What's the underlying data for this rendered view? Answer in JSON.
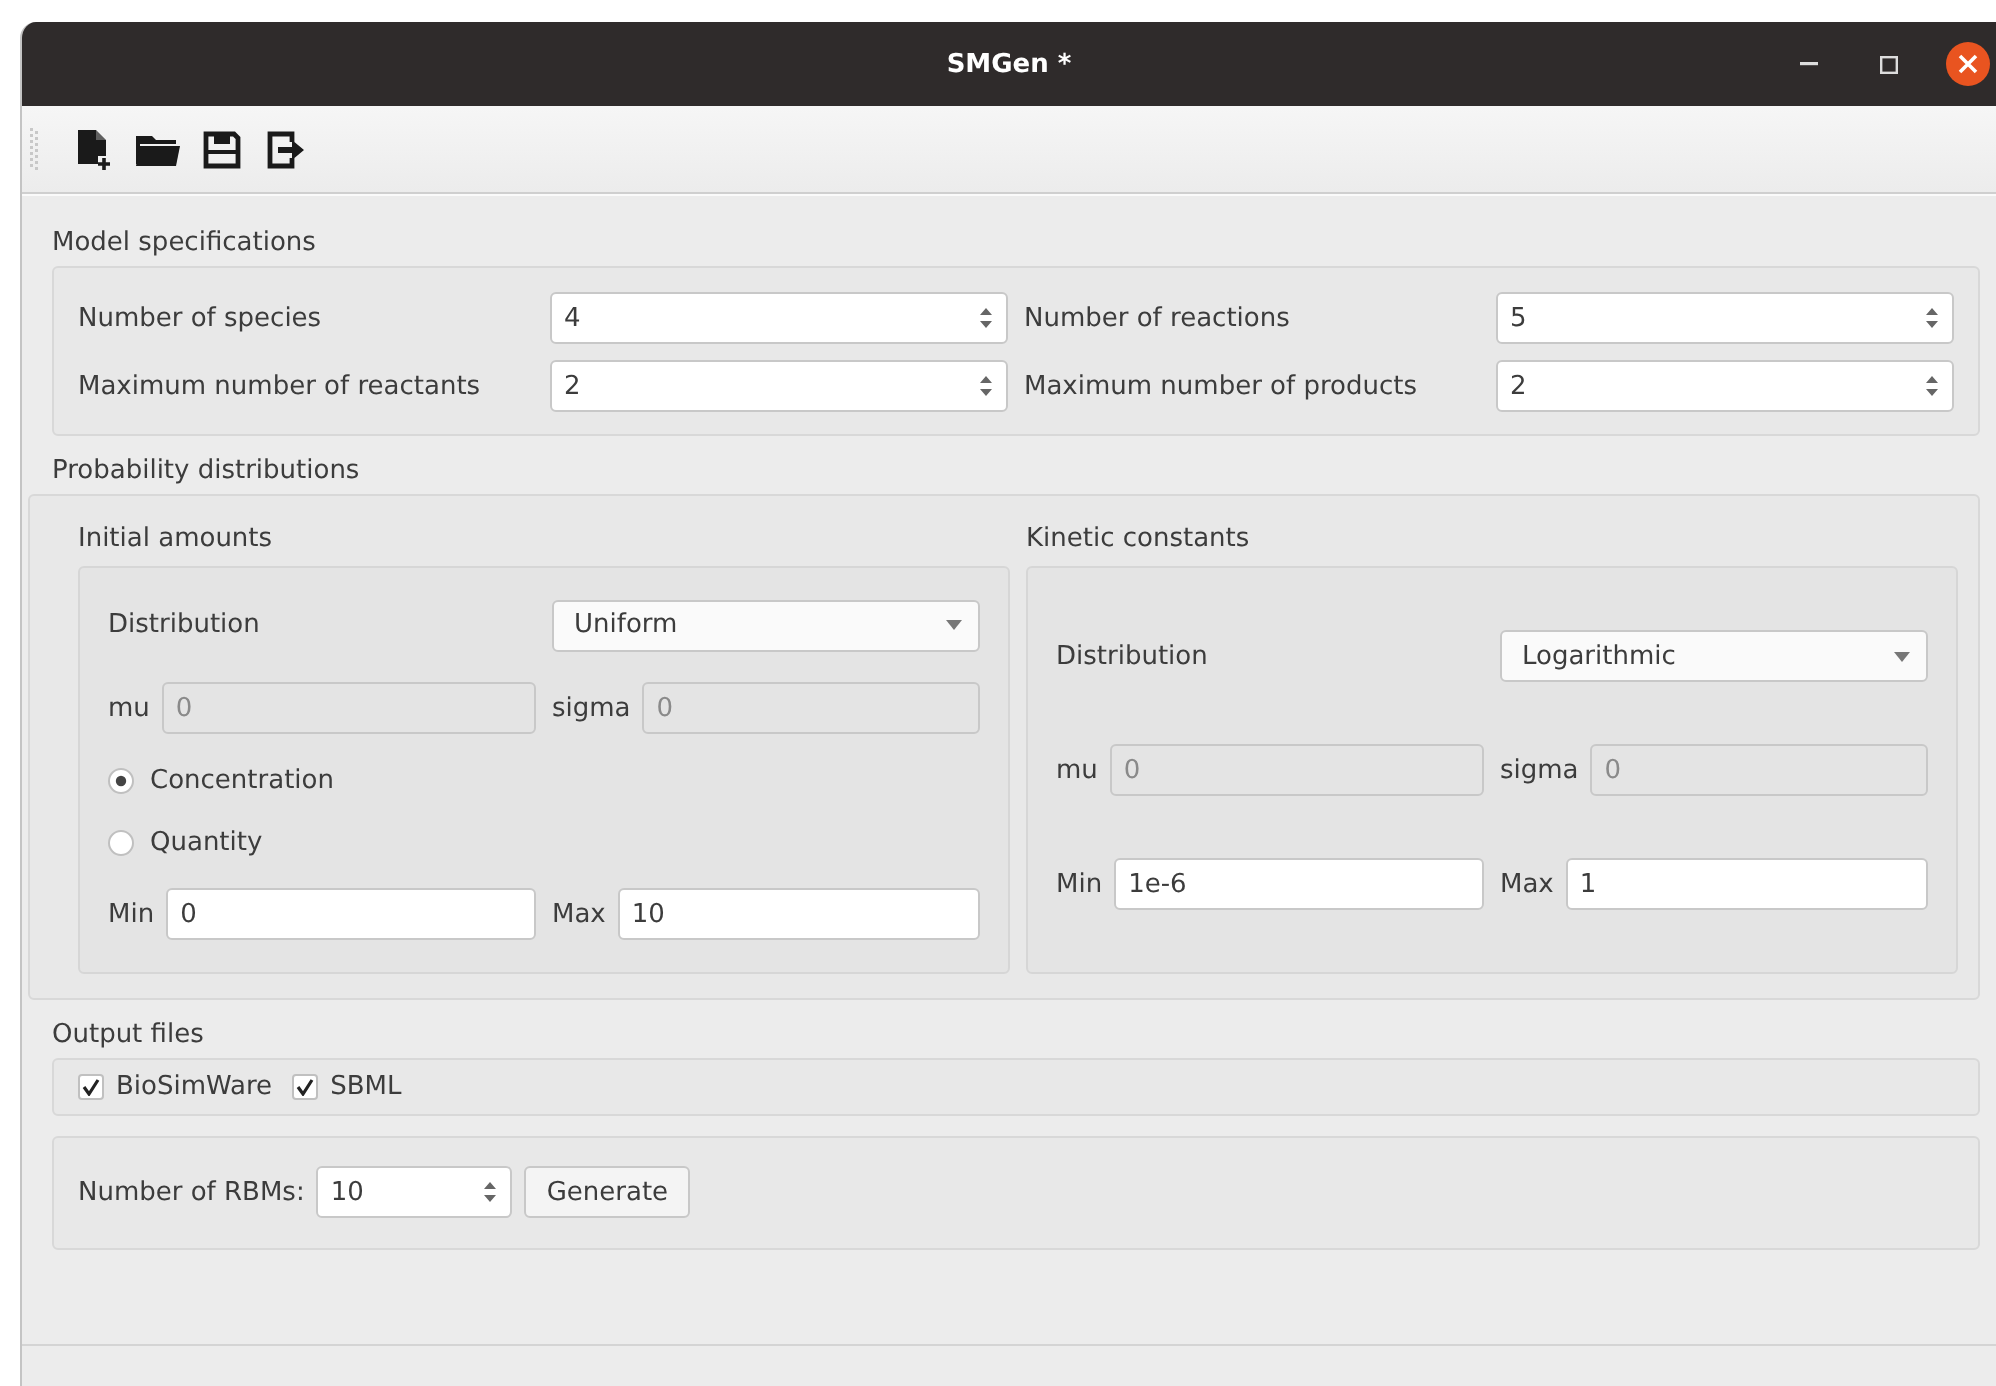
{
  "window": {
    "title": "SMGen *"
  },
  "model_specifications": {
    "title": "Model specifications",
    "fields": [
      {
        "label": "Number of species",
        "value": "4"
      },
      {
        "label": "Number of reactions",
        "value": "5"
      },
      {
        "label": "Maximum number of reactants",
        "value": "2"
      },
      {
        "label": "Maximum number of products",
        "value": "2"
      }
    ]
  },
  "probability_distributions": {
    "title": "Probability distributions",
    "panels": [
      {
        "title": "Initial amounts",
        "distribution_label": "Distribution",
        "distribution": "Uniform",
        "mu_label": "mu",
        "mu": "0",
        "sigma_label": "sigma",
        "sigma": "0",
        "params_disabled": true,
        "radios": [
          {
            "label": "Concentration",
            "selected": true
          },
          {
            "label": "Quantity",
            "selected": false
          }
        ],
        "min_label": "Min",
        "min": "0",
        "max_label": "Max",
        "max": "10"
      },
      {
        "title": "Kinetic constants",
        "distribution_label": "Distribution",
        "distribution": "Logarithmic",
        "mu_label": "mu",
        "mu": "0",
        "sigma_label": "sigma",
        "sigma": "0",
        "params_disabled": true,
        "min_label": "Min",
        "min": "1e-6",
        "max_label": "Max",
        "max": "1"
      }
    ]
  },
  "output_files": {
    "title": "Output files",
    "options": [
      {
        "label": "BioSimWare",
        "checked": true
      },
      {
        "label": "SBML",
        "checked": true
      }
    ]
  },
  "generation": {
    "label": "Number of RBMs:",
    "value": "10",
    "button": "Generate"
  }
}
